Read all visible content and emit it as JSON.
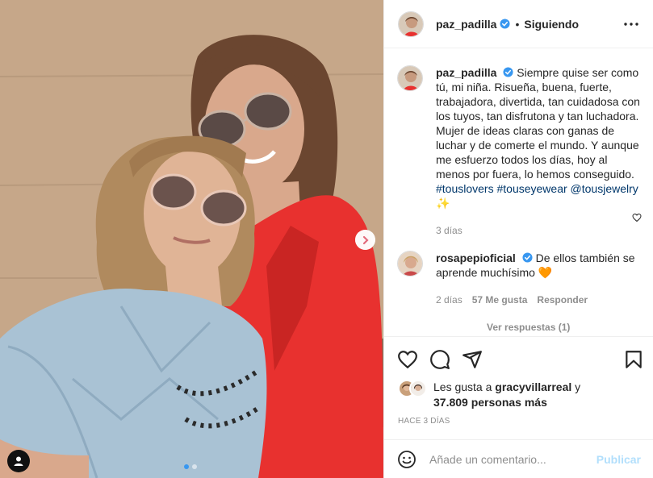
{
  "post": {
    "author": "paz_padilla",
    "follow_status": "Siguiendo",
    "separator": "•",
    "caption": {
      "author": "paz_padilla",
      "text": "Siempre quise ser como tú, mi niña. Risueña, buena, fuerte, trabajadora, divertida, tan cuidadosa con los tuyos, tan disfrutona y tan luchadora. Mujer de ideas claras con ganas de luchar y de comerte el mundo. Y aunque me esfuerzo todos los días, hoy al menos por fuera, lo hemos conseguido.",
      "tags": [
        "#touslovers",
        "#touseyewear",
        "@tousjewelry"
      ],
      "sparkle": "✨",
      "time": "3 días"
    },
    "comments": [
      {
        "author": "rosapepioficial",
        "text": "De ellos también se aprende muchísimo",
        "emoji": "🧡",
        "time": "2 días",
        "likes": "57 Me gusta",
        "reply_label": "Responder",
        "view_replies": "Ver respuestas (1)"
      }
    ],
    "likes": {
      "prefix": "Les gusta a",
      "user": "gracyvillarreal",
      "conj": "y",
      "others": "37.809 personas más"
    },
    "posted": "HACE 3 DÍAS",
    "carousel": {
      "current": 1,
      "total": 2
    }
  },
  "add_comment": {
    "placeholder": "Añade un comentario...",
    "publish_label": "Publicar"
  },
  "colors": {
    "verified": "#3897f0",
    "hashtag": "#00376b",
    "publish_disabled": "#b2dffc",
    "jacket": "#e8312f",
    "sweater": "#a9c2d4"
  },
  "icons": {
    "verified": "verified-badge-icon",
    "more": "more-options-icon",
    "next": "chevron-right-icon",
    "tag": "user-tag-icon",
    "like": "heart-icon",
    "comment": "comment-bubble-icon",
    "share": "paper-plane-icon",
    "save": "bookmark-icon",
    "emoji": "smiley-icon"
  }
}
